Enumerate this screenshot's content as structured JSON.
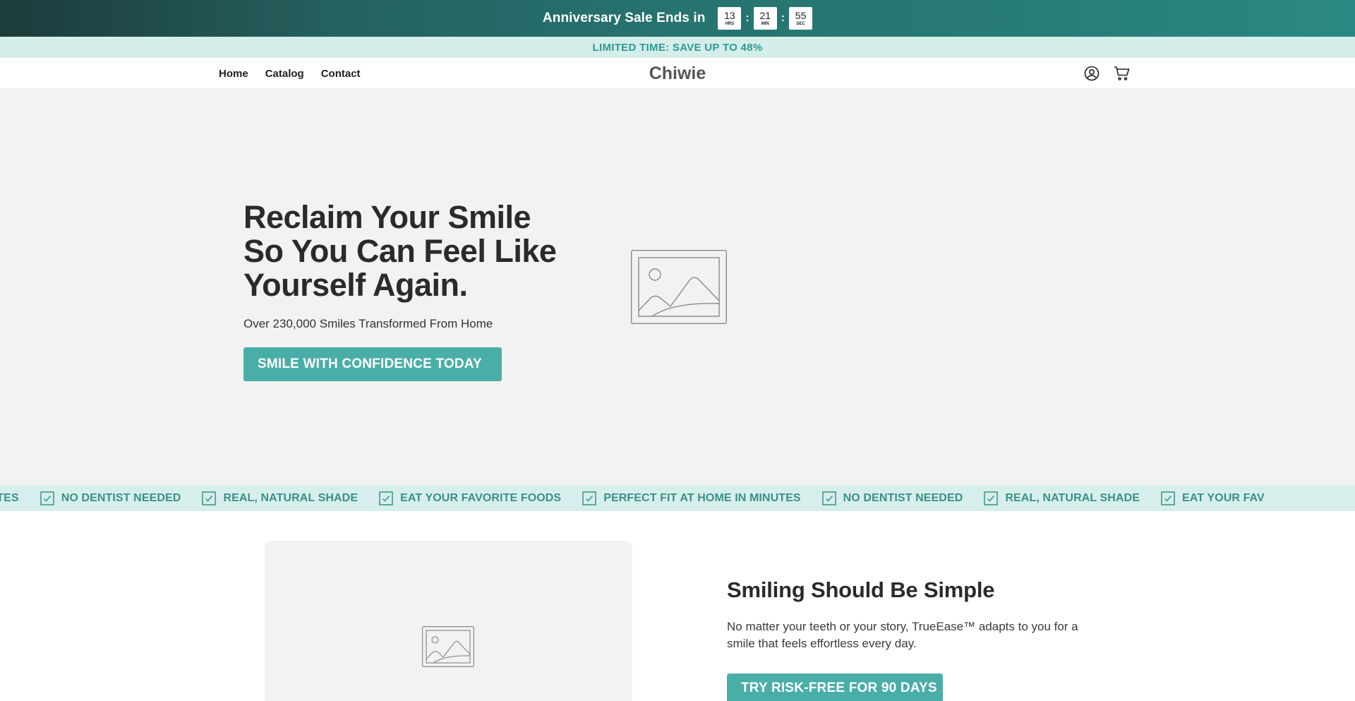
{
  "announcement": {
    "text": "Anniversary Sale Ends in",
    "timer": [
      {
        "value": "13",
        "unit": "HRS"
      },
      {
        "value": "21",
        "unit": "MIN"
      },
      {
        "value": "55",
        "unit": "SEC"
      }
    ],
    "separator": ":"
  },
  "promo": {
    "text": "LIMITED TIME: SAVE UP TO 48%"
  },
  "header": {
    "nav": [
      {
        "label": "Home"
      },
      {
        "label": "Catalog"
      },
      {
        "label": "Contact"
      }
    ],
    "logo": "Chiwie",
    "icons": [
      "account-icon",
      "cart-icon"
    ]
  },
  "hero": {
    "title": "Reclaim Your Smile So You Can Feel Like Yourself Again.",
    "subtitle": "Over 230,000 Smiles Transformed From Home",
    "cta": "SMILE WITH CONFIDENCE TODAY",
    "image_icon": "image-placeholder-icon"
  },
  "marquee": {
    "items": [
      "NUTES",
      "NO DENTIST NEEDED",
      "REAL, NATURAL SHADE",
      "EAT YOUR FAVORITE FOODS",
      "PERFECT FIT AT HOME IN MINUTES",
      "NO DENTIST NEEDED",
      "REAL, NATURAL SHADE",
      "EAT YOUR FAV"
    ],
    "icon": "checkbox-icon"
  },
  "feature": {
    "title": "Smiling Should Be Simple",
    "description": "No matter your teeth or your story, TrueEase™ adapts to you for a smile that feels effortless every day.",
    "cta": "TRY RISK-FREE FOR 90 DAYS",
    "image_icon": "image-placeholder-icon"
  },
  "colors": {
    "accent": "#4aaea8",
    "promo_bg": "#d4eeea",
    "marquee_text": "#3b8f88",
    "hero_bg": "#f2f2f2"
  }
}
